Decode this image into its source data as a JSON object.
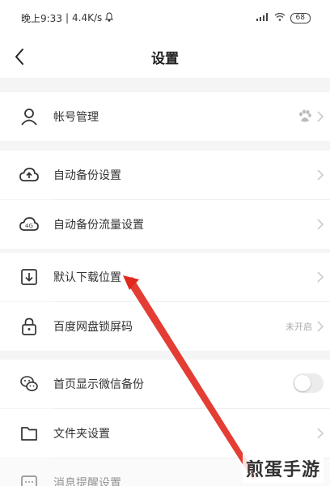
{
  "status_bar": {
    "time": "晚上9:33",
    "network_speed": "4.4K/s",
    "battery": "68"
  },
  "header": {
    "title": "设置"
  },
  "settings": {
    "account": {
      "label": "帐号管理"
    },
    "auto_backup": {
      "label": "自动备份设置"
    },
    "auto_backup_traffic": {
      "label": "自动备份流量设置"
    },
    "default_download": {
      "label": "默认下载位置"
    },
    "lock_screen": {
      "label": "百度网盘锁屏码",
      "value": "未开启"
    },
    "wechat_backup": {
      "label": "首页显示微信备份",
      "enabled": false
    },
    "folder_settings": {
      "label": "文件夹设置"
    },
    "notification": {
      "label": "消息提醒设置"
    }
  },
  "watermark": "煎蛋手游",
  "colors": {
    "arrow": "#e0281e",
    "row_bg": "#ffffff",
    "page_bg": "#f5f5f5"
  }
}
